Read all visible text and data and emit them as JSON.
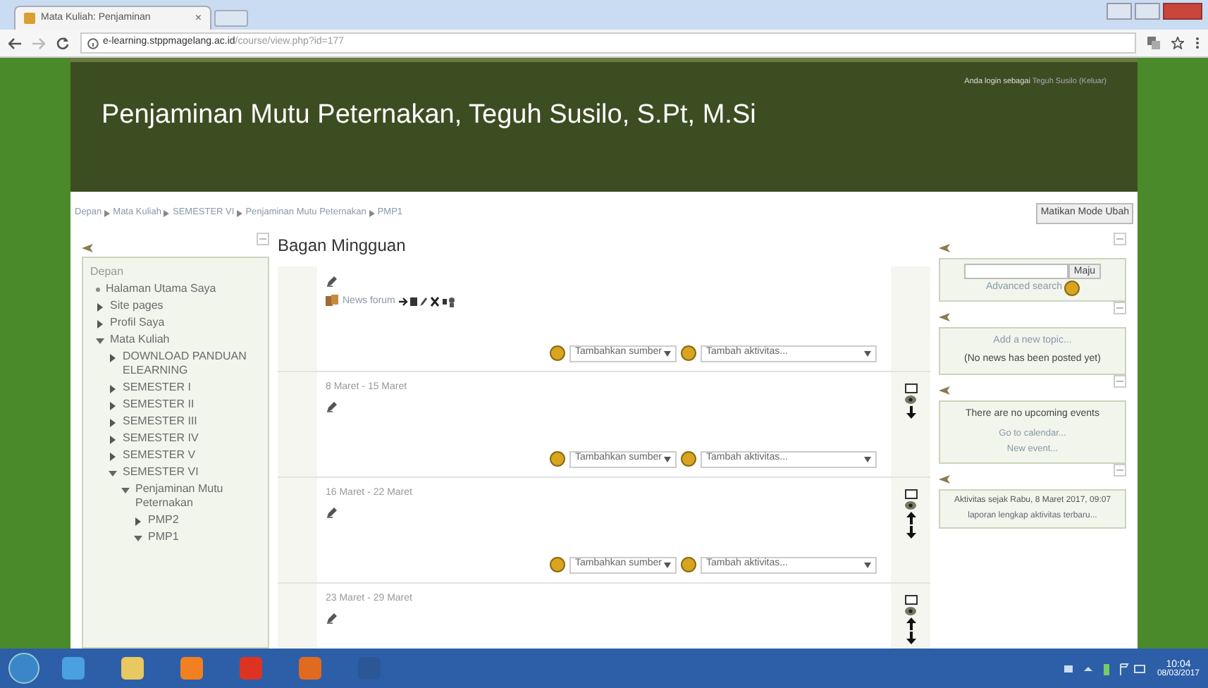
{
  "browser": {
    "tab_title": "Mata Kuliah: Penjaminan",
    "tab_close": "×",
    "url_host": "e-learning.stppmagelang.ac.id",
    "url_path": "/course/view.php?id=177"
  },
  "header": {
    "title": "Penjaminan Mutu Peternakan, Teguh Susilo, S.Pt, M.Si",
    "login_text": "Anda login sebagai",
    "login_user": "Teguh Susilo",
    "logout": "(Keluar)"
  },
  "breadcrumb": [
    "Depan",
    "Mata Kuliah",
    "SEMESTER VI",
    "Penjaminan Mutu Peternakan",
    "PMP1"
  ],
  "edit_mode_button": "Matikan Mode Ubah",
  "navigation": {
    "items": [
      {
        "label": "Depan",
        "kind": "root"
      },
      {
        "label": "Halaman Utama Saya",
        "kind": "bullet"
      },
      {
        "label": "Site pages",
        "kind": "branch",
        "expanded": false
      },
      {
        "label": "Profil Saya",
        "kind": "branch",
        "expanded": false
      },
      {
        "label": "Mata Kuliah",
        "kind": "branch",
        "expanded": true,
        "children": [
          {
            "label": "DOWNLOAD PANDUAN ELEARNING",
            "kind": "branch",
            "expanded": false
          },
          {
            "label": "SEMESTER I",
            "kind": "branch",
            "expanded": false
          },
          {
            "label": "SEMESTER II",
            "kind": "branch",
            "expanded": false
          },
          {
            "label": "SEMESTER III",
            "kind": "branch",
            "expanded": false
          },
          {
            "label": "SEMESTER IV",
            "kind": "branch",
            "expanded": false
          },
          {
            "label": "SEMESTER V",
            "kind": "branch",
            "expanded": false
          },
          {
            "label": "SEMESTER VI",
            "kind": "branch",
            "expanded": true,
            "children": [
              {
                "label": "Penjaminan Mutu Peternakan",
                "kind": "branch",
                "expanded": true,
                "children": [
                  {
                    "label": "PMP2",
                    "kind": "branch",
                    "expanded": false
                  },
                  {
                    "label": "PMP1",
                    "kind": "branch",
                    "expanded": true
                  }
                ]
              }
            ]
          }
        ]
      }
    ]
  },
  "main": {
    "title": "Bagan Mingguan",
    "sections": [
      {
        "kind": "general",
        "news_forum": "News forum",
        "add_resource": "Tambahkan sumber",
        "add_activity": "Tambah aktivitas..."
      },
      {
        "kind": "week",
        "dates": "8 Maret - 15 Maret",
        "move_up": false,
        "move_down": true,
        "add_resource": "Tambahkan sumber",
        "add_activity": "Tambah aktivitas..."
      },
      {
        "kind": "week",
        "dates": "16 Maret - 22 Maret",
        "move_up": true,
        "move_down": true,
        "add_resource": "Tambahkan sumber",
        "add_activity": "Tambah aktivitas..."
      },
      {
        "kind": "week",
        "dates": "23 Maret - 29 Maret",
        "move_up": true,
        "move_down": true
      }
    ]
  },
  "search_block": {
    "button": "Maju",
    "advanced": "Advanced search"
  },
  "news_block": {
    "add_topic": "Add a new topic...",
    "empty": "(No news has been posted yet)"
  },
  "events_block": {
    "message": "There are no upcoming events",
    "links": [
      "Go to calendar...",
      "New event..."
    ]
  },
  "activity_block": {
    "since": "Aktivitas sejak Rabu, 8 Maret 2017, 09:07",
    "report": "laporan lengkap aktivitas terbaru..."
  },
  "taskbar": {
    "time": "10:04",
    "date": "08/03/2017"
  }
}
